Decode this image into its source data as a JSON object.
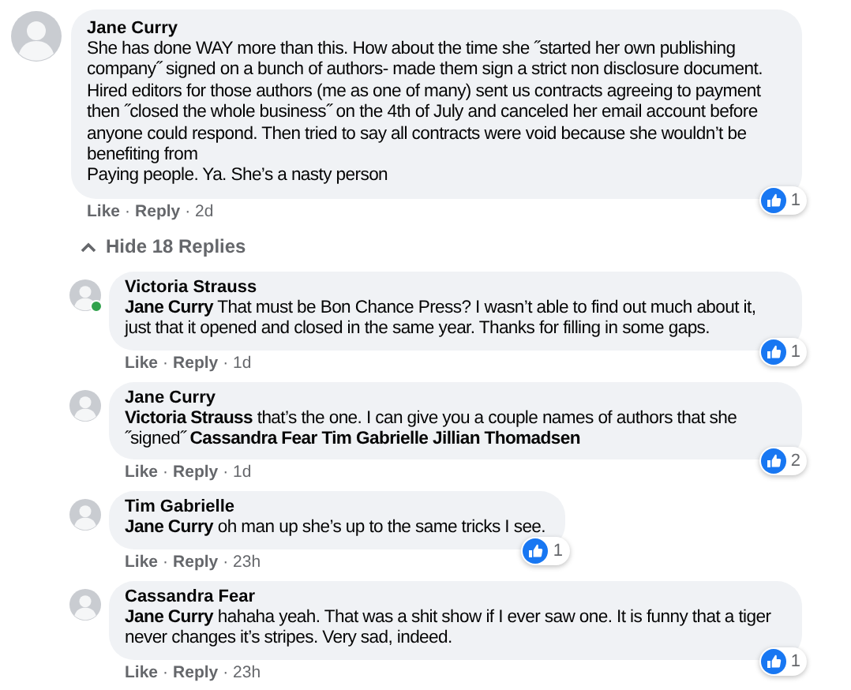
{
  "comment": {
    "author": "Jane Curry",
    "text": "She has done WAY more than this. How about the time she ˝started her own publishing company˝ signed on a bunch of authors- made them sign a strict non disclosure document. Hired editors for those authors (me as one of many) sent us contracts agreeing to payment then ˝closed the whole business˝ on the 4th of July and canceled her email account before anyone could respond. Then tried to say all contracts were void because she wouldn’t be benefiting from\nPaying people. Ya. She’s a nasty person",
    "like": "Like",
    "separator": "·",
    "reply": "Reply",
    "time": "· 2d",
    "reaction_count": "1",
    "online": false
  },
  "replies_toggle": {
    "label": "Hide 18 Replies",
    "expanded": true
  },
  "replies": [
    {
      "author": "Victoria Strauss",
      "text": "**Jane Curry** That must be Bon Chance Press? I wasn’t able to find out much about it, just that it opened and closed in the same year. Thanks for filling in some gaps.",
      "like": "Like",
      "separator": "·",
      "reply": "Reply",
      "time": "· 1d",
      "reaction_count": "1",
      "online": true
    },
    {
      "author": "Jane Curry",
      "text": "**Victoria Strauss** that’s the one. I can give you a couple names of authors that she ˝signed˝ **Cassandra Fear** **Tim Gabrielle** **Jillian Thomadsen**",
      "like": "Like",
      "separator": "·",
      "reply": "Reply",
      "time": "· 1d",
      "reaction_count": "2",
      "online": false
    },
    {
      "author": "Tim Gabrielle",
      "text": "**Jane Curry** oh man up she’s up to the same tricks I see.",
      "like": "Like",
      "separator": "·",
      "reply": "Reply",
      "time": "· 23h",
      "reaction_count": "1",
      "online": false
    },
    {
      "author": "Cassandra Fear",
      "text": "**Jane Curry** hahaha yeah. That was a shit show if I ever saw one. It is funny that a tiger never changes it’s stripes. Very sad, indeed.",
      "like": "Like",
      "separator": "·",
      "reply": "Reply",
      "time": "· 23h",
      "reaction_count": "1",
      "online": false
    }
  ]
}
